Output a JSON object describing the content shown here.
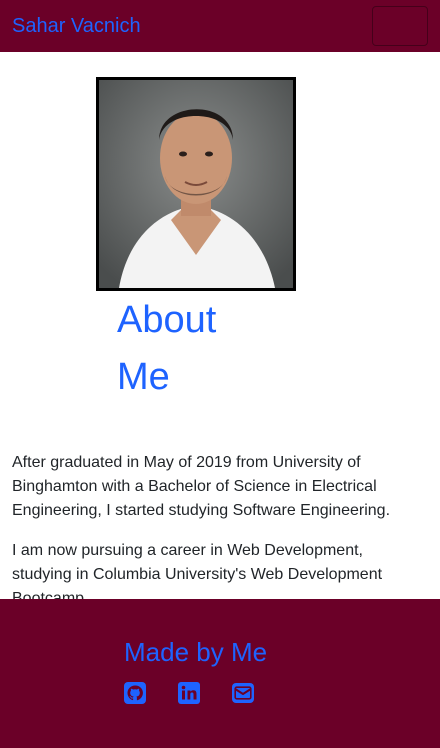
{
  "nav": {
    "brand": "Sahar Vacnich"
  },
  "about": {
    "heading": "About Me",
    "paragraphs": [
      "After graduated in May of 2019 from University of Binghamton with a Bachelor of Science in Electrical Engineering, I started studying Software Engineering.",
      "I am now pursuing a career in Web Development, studying in Columbia University's Web Development Bootcamp."
    ]
  },
  "footer": {
    "title": "Made by Me",
    "icons": [
      "github-icon",
      "linkedin-icon",
      "email-icon"
    ]
  },
  "colors": {
    "primary": "#1e63ff",
    "maroon": "#6b0028",
    "text": "#212529"
  }
}
